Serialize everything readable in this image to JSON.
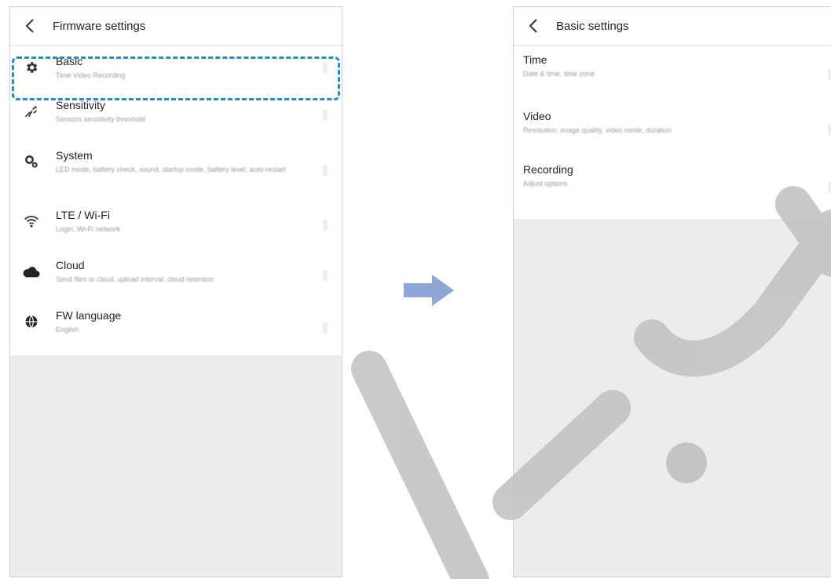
{
  "left_screen": {
    "title": "Firmware settings",
    "items": [
      {
        "label": "Basic",
        "subtitle": "Time Video Recording",
        "icon": "gear-icon"
      },
      {
        "label": "Sensitivity",
        "subtitle": "Sensors sensitivity threshold",
        "icon": "sensitivity-icon"
      },
      {
        "label": "System",
        "subtitle": "LED mode, battery check, sound, startup mode, battery level, auto-restart",
        "icon": "gears-icon"
      },
      {
        "label": "LTE / Wi-Fi",
        "subtitle": "Login, Wi-Fi network",
        "icon": "wifi-icon"
      },
      {
        "label": "Cloud",
        "subtitle": "Send files to cloud, upload interval, cloud retention",
        "icon": "cloud-icon"
      },
      {
        "label": "FW language",
        "subtitle": "English",
        "icon": "globe-icon"
      }
    ]
  },
  "right_screen": {
    "title": "Basic settings",
    "items": [
      {
        "label": "Time",
        "subtitle": "Date & time, time zone"
      },
      {
        "label": "Video",
        "subtitle": "Resolution, image quality, video mode, duration"
      },
      {
        "label": "Recording",
        "subtitle": "Adjust options"
      }
    ]
  },
  "colors": {
    "highlight": "#1f8ec9",
    "arrow": "#8ea7d9",
    "watermark": "#c4c4c4"
  }
}
